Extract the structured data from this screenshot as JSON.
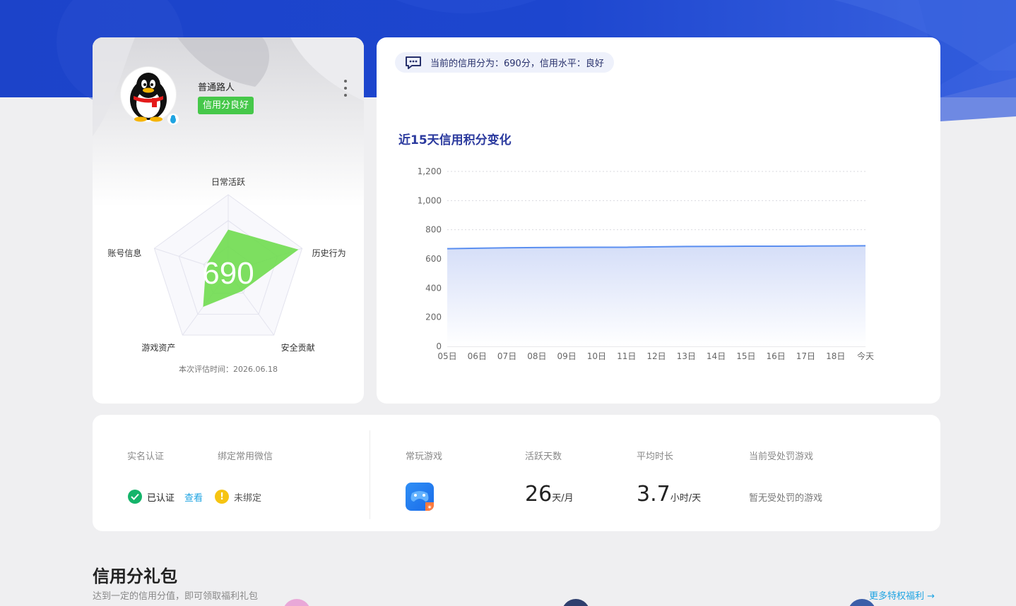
{
  "profile": {
    "nickname": "普通路人",
    "credit_tag": "信用分良好",
    "score": "690",
    "radar_labels": [
      "日常活跃",
      "历史行为",
      "安全贡献",
      "游戏资产",
      "账号信息"
    ],
    "radar_values": [
      0.55,
      0.95,
      0.3,
      0.55,
      0.3
    ],
    "eval_time": "本次评估时间：2026.06.18",
    "avatar_icon": "qq-penguin-icon",
    "more_icon": "more-vertical-icon"
  },
  "notice": {
    "icon": "message-icon",
    "text": "当前的信用分为：690分，信用水平：良好"
  },
  "trend": {
    "title": "近15天信用积分变化"
  },
  "chart_data": {
    "type": "area",
    "title": "近15天信用积分变化",
    "x": [
      "05日",
      "06日",
      "07日",
      "08日",
      "09日",
      "10日",
      "11日",
      "12日",
      "13日",
      "14日",
      "15日",
      "16日",
      "17日",
      "18日",
      "今天"
    ],
    "series": [
      {
        "values": [
          670,
          673,
          676,
          678,
          679,
          680,
          680,
          683,
          685,
          686,
          687,
          687,
          688,
          689,
          690
        ]
      }
    ],
    "ylim": [
      0,
      1200
    ],
    "yticks": [
      "0",
      "200",
      "400",
      "600",
      "800",
      "1,000",
      "1,200"
    ],
    "grid": true,
    "colors": {
      "line": "#5b8ff0",
      "fill_top": "#d5def8"
    }
  },
  "stats": {
    "realname_label": "实名认证",
    "wechat_label": "绑定常用微信",
    "realname_status": "已认证",
    "view_link": "查看",
    "wechat_status": "未绑定",
    "games_label": "常玩游戏",
    "active_label": "活跃天数",
    "active_value": "26",
    "active_unit": "天/月",
    "avg_label": "平均时长",
    "avg_value": "3.7",
    "avg_unit": "小时/天",
    "penalty_label": "当前受处罚游戏",
    "penalty_value": "暂无受处罚的游戏"
  },
  "gift": {
    "title": "信用分礼包",
    "subtitle": "达到一定的信用分值，即可领取福利礼包",
    "more_link": "更多特权福利 →"
  },
  "colors": {
    "accent": "#2b3a9e",
    "good_green": "#46c84a",
    "link": "#1fa4e2",
    "hero_blue": "#1b3fc6"
  }
}
